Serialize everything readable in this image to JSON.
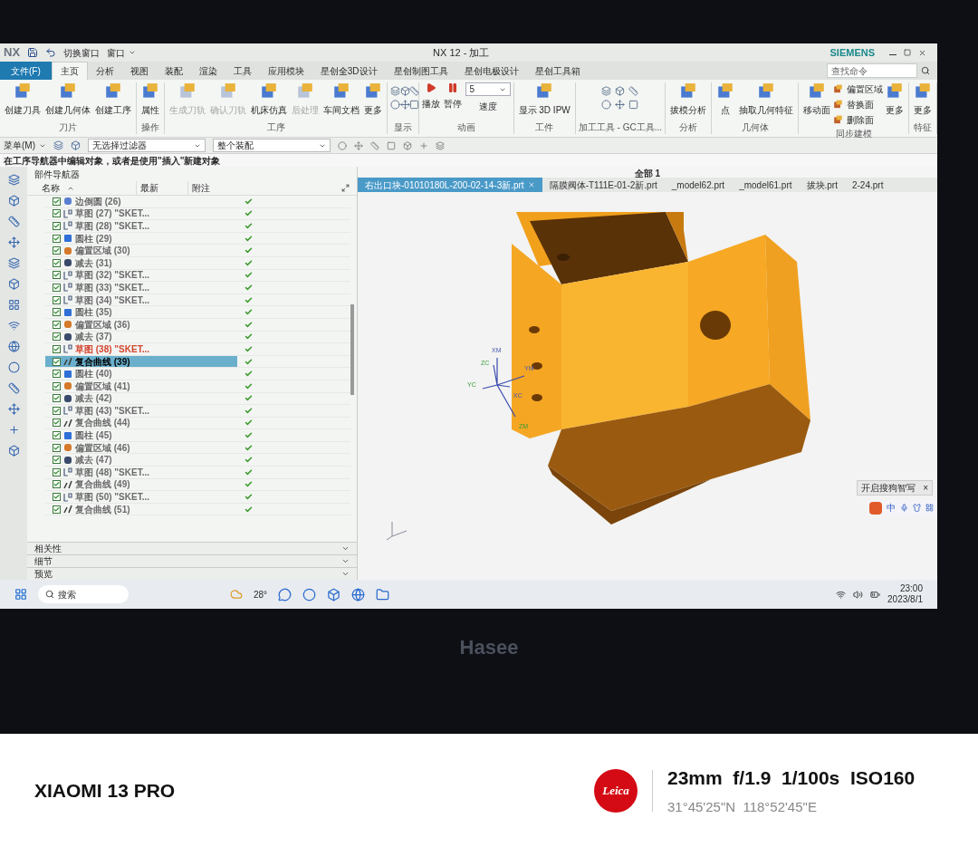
{
  "quick_access": {
    "logo": "NX",
    "switch_window": "切换窗口",
    "window_menu": "窗口"
  },
  "window": {
    "title": "NX 12 - 加工",
    "brand": "SIEMENS"
  },
  "ribbon_tabs": [
    {
      "label": "文件(F)",
      "kind": "file",
      "selected": false
    },
    {
      "label": "主页",
      "kind": "tab",
      "selected": true
    },
    {
      "label": "分析",
      "kind": "tab",
      "selected": false
    },
    {
      "label": "视图",
      "kind": "tab",
      "selected": false
    },
    {
      "label": "装配",
      "kind": "tab",
      "selected": false
    },
    {
      "label": "渲染",
      "kind": "tab",
      "selected": false
    },
    {
      "label": "工具",
      "kind": "tab",
      "selected": false
    },
    {
      "label": "应用模块",
      "kind": "tab",
      "selected": false
    },
    {
      "label": "星创全3D设计",
      "kind": "tab",
      "selected": false
    },
    {
      "label": "星创制图工具",
      "kind": "tab",
      "selected": false
    },
    {
      "label": "星创电极设计",
      "kind": "tab",
      "selected": false
    },
    {
      "label": "星创工具箱",
      "kind": "tab",
      "selected": false
    }
  ],
  "command_search": {
    "placeholder": "查找命令"
  },
  "ribbon_groups": [
    {
      "title": "刀片",
      "kind": "buttons",
      "buttons": [
        {
          "label": "创建刀具",
          "disabled": false,
          "kind": "large"
        },
        {
          "label": "创建几何体",
          "disabled": false,
          "kind": "large"
        },
        {
          "label": "创建工序",
          "disabled": false,
          "kind": "large"
        }
      ]
    },
    {
      "title": "操作",
      "kind": "buttons",
      "buttons": [
        {
          "label": "属性",
          "disabled": false,
          "kind": "large"
        }
      ]
    },
    {
      "title": "工序",
      "kind": "buttons",
      "buttons": [
        {
          "label": "生成刀轨",
          "disabled": true,
          "kind": "large"
        },
        {
          "label": "确认刀轨",
          "disabled": true,
          "kind": "large"
        },
        {
          "label": "机床仿真",
          "disabled": false,
          "kind": "large"
        },
        {
          "label": "后处理",
          "disabled": true,
          "kind": "large"
        },
        {
          "label": "车间文档",
          "disabled": false,
          "kind": "large"
        },
        {
          "label": "更多",
          "disabled": false,
          "kind": "large"
        }
      ]
    },
    {
      "title": "显示",
      "kind": "icons"
    },
    {
      "title": "动画",
      "kind": "animation",
      "buttons": [
        {
          "label": "播放",
          "disabled": false
        },
        {
          "label": "暂停",
          "disabled": false
        }
      ],
      "speed_value": "5",
      "speed_label": "速度"
    },
    {
      "title": "工件",
      "kind": "buttons",
      "buttons": [
        {
          "label": "显示 3D IPW",
          "disabled": false,
          "kind": "large"
        }
      ]
    },
    {
      "title": "加工工具 - GC工具...",
      "kind": "icons"
    },
    {
      "title": "分析",
      "kind": "buttons",
      "buttons": [
        {
          "label": "拔模分析",
          "disabled": false,
          "kind": "large"
        }
      ]
    },
    {
      "title": "几何体",
      "kind": "buttons",
      "buttons": [
        {
          "label": "点",
          "disabled": false,
          "kind": "large"
        },
        {
          "label": "抽取几何特征",
          "disabled": false,
          "kind": "large"
        }
      ]
    },
    {
      "title": "同步建模",
      "kind": "buttons",
      "buttons": [
        {
          "label": "移动面",
          "disabled": false,
          "kind": "large"
        },
        {
          "label": "偏置区域",
          "disabled": false,
          "kind": "small"
        },
        {
          "label": "替换面",
          "disabled": false,
          "kind": "small"
        },
        {
          "label": "删除面",
          "disabled": false,
          "kind": "small"
        },
        {
          "label": "更多",
          "disabled": false,
          "kind": "large"
        }
      ]
    },
    {
      "title": "特征",
      "kind": "buttons",
      "buttons": [
        {
          "label": "更多",
          "disabled": false,
          "kind": "large"
        }
      ]
    }
  ],
  "selection_bar": {
    "menu": "菜单(M)",
    "filter": "无选择过滤器",
    "scope": "整个装配"
  },
  "cue_line": "在工序导航器中编辑对象，或者是使用\"插入\"新建对象",
  "navigator": {
    "title": "部件导航器",
    "columns": [
      "名称",
      "最新",
      "附注"
    ],
    "rows": [
      {
        "label": "边倒圆 (26)",
        "kind": "blend",
        "checked": true,
        "up_to_date": true,
        "selected": false,
        "warning": false
      },
      {
        "label": "草图 (27) \"SKET...",
        "kind": "sketch",
        "checked": true,
        "up_to_date": true,
        "selected": false,
        "warning": false
      },
      {
        "label": "草图 (28) \"SKET...",
        "kind": "sketch",
        "checked": true,
        "up_to_date": true,
        "selected": false,
        "warning": false
      },
      {
        "label": "圆柱 (29)",
        "kind": "cylinder",
        "checked": true,
        "up_to_date": true,
        "selected": false,
        "warning": false
      },
      {
        "label": "偏置区域 (30)",
        "kind": "offset",
        "checked": true,
        "up_to_date": true,
        "selected": false,
        "warning": false
      },
      {
        "label": "减去 (31)",
        "kind": "subtract",
        "checked": true,
        "up_to_date": true,
        "selected": false,
        "warning": false
      },
      {
        "label": "草图 (32) \"SKET...",
        "kind": "sketch",
        "checked": true,
        "up_to_date": true,
        "selected": false,
        "warning": false
      },
      {
        "label": "草图 (33) \"SKET...",
        "kind": "sketch",
        "checked": true,
        "up_to_date": true,
        "selected": false,
        "warning": false
      },
      {
        "label": "草图 (34) \"SKET...",
        "kind": "sketch",
        "checked": true,
        "up_to_date": true,
        "selected": false,
        "warning": false
      },
      {
        "label": "圆柱 (35)",
        "kind": "cylinder",
        "checked": true,
        "up_to_date": true,
        "selected": false,
        "warning": false
      },
      {
        "label": "偏置区域 (36)",
        "kind": "offset",
        "checked": true,
        "up_to_date": true,
        "selected": false,
        "warning": false
      },
      {
        "label": "减去 (37)",
        "kind": "subtract",
        "checked": true,
        "up_to_date": true,
        "selected": false,
        "warning": false
      },
      {
        "label": "草图 (38) \"SKET...",
        "kind": "sketch",
        "checked": true,
        "up_to_date": true,
        "selected": false,
        "warning": true
      },
      {
        "label": "复合曲线 (39)",
        "kind": "curve",
        "checked": true,
        "up_to_date": true,
        "selected": true,
        "warning": false
      },
      {
        "label": "圆柱 (40)",
        "kind": "cylinder",
        "checked": true,
        "up_to_date": true,
        "selected": false,
        "warning": false
      },
      {
        "label": "偏置区域 (41)",
        "kind": "offset",
        "checked": true,
        "up_to_date": true,
        "selected": false,
        "warning": false
      },
      {
        "label": "减去 (42)",
        "kind": "subtract",
        "checked": true,
        "up_to_date": true,
        "selected": false,
        "warning": false
      },
      {
        "label": "草图 (43) \"SKET...",
        "kind": "sketch",
        "checked": true,
        "up_to_date": true,
        "selected": false,
        "warning": false
      },
      {
        "label": "复合曲线 (44)",
        "kind": "curve",
        "checked": true,
        "up_to_date": true,
        "selected": false,
        "warning": false
      },
      {
        "label": "圆柱 (45)",
        "kind": "cylinder",
        "checked": true,
        "up_to_date": true,
        "selected": false,
        "warning": false
      },
      {
        "label": "偏置区域 (46)",
        "kind": "offset",
        "checked": true,
        "up_to_date": true,
        "selected": false,
        "warning": false
      },
      {
        "label": "减去 (47)",
        "kind": "subtract",
        "checked": true,
        "up_to_date": true,
        "selected": false,
        "warning": false
      },
      {
        "label": "草图 (48) \"SKET...",
        "kind": "sketch",
        "checked": true,
        "up_to_date": true,
        "selected": false,
        "warning": false
      },
      {
        "label": "复合曲线 (49)",
        "kind": "curve",
        "checked": true,
        "up_to_date": true,
        "selected": false,
        "warning": false
      },
      {
        "label": "草图 (50) \"SKET...",
        "kind": "sketch",
        "checked": true,
        "up_to_date": true,
        "selected": false,
        "warning": false
      },
      {
        "label": "复合曲线 (51)",
        "kind": "curve",
        "checked": true,
        "up_to_date": true,
        "selected": false,
        "warning": false
      }
    ],
    "sections": [
      {
        "label": "相关性",
        "expanded": false
      },
      {
        "label": "细节",
        "expanded": false
      },
      {
        "label": "预览",
        "expanded": false
      }
    ]
  },
  "graphics": {
    "scope_label": "全部 1",
    "file_tabs": [
      {
        "label": "右出口块-01010180L-200-02-14-3新.prt",
        "selected": true
      },
      {
        "label": "隔膜阀体-T111E-01-2新.prt",
        "selected": false
      },
      {
        "label": "_model62.prt",
        "selected": false
      },
      {
        "label": "_model61.prt",
        "selected": false
      },
      {
        "label": "拔块.prt",
        "selected": false
      },
      {
        "label": "2-24.prt",
        "selected": false
      }
    ],
    "triad_labels": [
      "XM",
      "ZC",
      "YM",
      "YC",
      "XC",
      "ZM"
    ],
    "popup": {
      "text": "开启搜狗智写",
      "close": "×"
    },
    "ime_mode": "中"
  },
  "taskbar": {
    "search": "搜索",
    "weather": "28°",
    "time": "23:00",
    "date": "2023/8/1"
  },
  "bezel_logo": "Hasee",
  "photo_info": {
    "device": "XIAOMI 13 PRO",
    "lens_brand": "Leica",
    "exposure": "23mm  f/1.9  1/100s  ISO160",
    "location": "31°45'25\"N  118°52'45\"E"
  }
}
